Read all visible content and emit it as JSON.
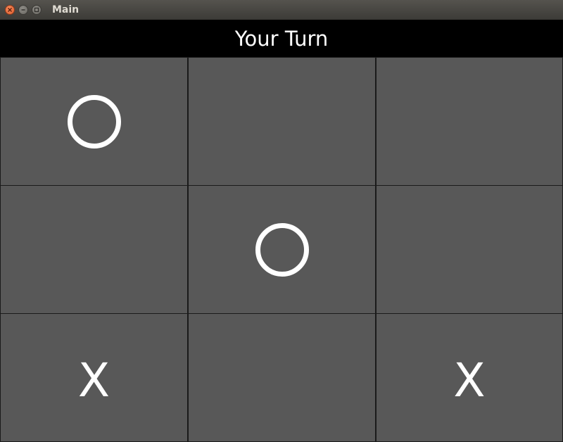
{
  "window": {
    "title": "Main"
  },
  "status": {
    "text": "Your Turn"
  },
  "board": {
    "cells": [
      {
        "mark": "O"
      },
      {
        "mark": ""
      },
      {
        "mark": ""
      },
      {
        "mark": ""
      },
      {
        "mark": "O"
      },
      {
        "mark": ""
      },
      {
        "mark": "X"
      },
      {
        "mark": ""
      },
      {
        "mark": "X"
      }
    ]
  },
  "colors": {
    "cell_background": "#585858",
    "cell_border": "#1a1a1a",
    "mark": "#ffffff",
    "status_background": "#000000"
  }
}
